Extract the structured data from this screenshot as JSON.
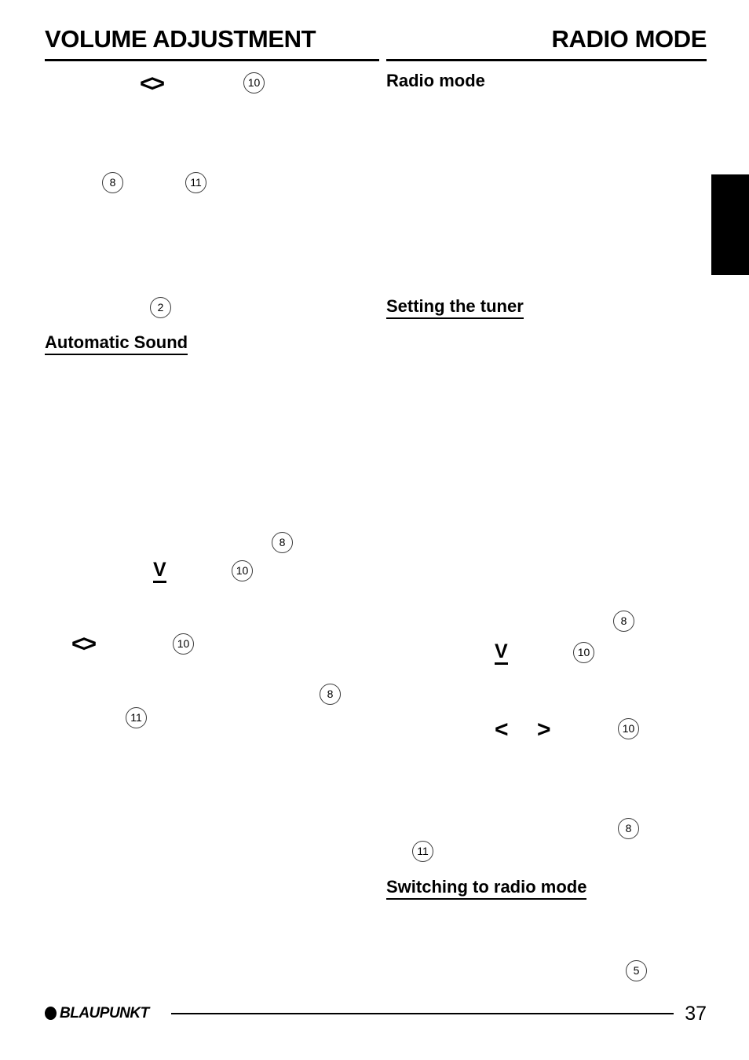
{
  "header": {
    "left_title": "VOLUME ADJUSTMENT",
    "right_title": "RADIO MODE"
  },
  "columns": {
    "left": {
      "headings": [
        {
          "text": "Automatic Sound",
          "underlined": true
        }
      ],
      "symbols": [
        {
          "glyph": "<>",
          "style": "chevron-pair"
        },
        {
          "glyph": "V",
          "style": "v-underlined"
        },
        {
          "glyph": "<>",
          "style": "chevron-pair"
        }
      ],
      "callouts": [
        "10",
        "8",
        "11",
        "2",
        "8",
        "10",
        "10",
        "8",
        "11"
      ]
    },
    "right": {
      "headings": [
        {
          "text": "Radio mode",
          "underlined": false
        },
        {
          "text": "Setting the tuner",
          "underlined": true
        },
        {
          "text": "Switching to radio mode",
          "underlined": true
        }
      ],
      "symbols": [
        {
          "glyph": "V",
          "style": "v-underlined"
        },
        {
          "glyph": "<",
          "style": "chevron-left"
        },
        {
          "glyph": ">",
          "style": "chevron-right"
        }
      ],
      "callouts": [
        "8",
        "10",
        "10",
        "8",
        "11",
        "5"
      ]
    }
  },
  "footer": {
    "brand": "BLAUPUNKT",
    "brand_dot": "filled-ellipse-icon",
    "page_number": "37"
  },
  "colors": {
    "ink": "#000000",
    "paper": "#ffffff",
    "callout_stroke": "#3a3a3a"
  }
}
